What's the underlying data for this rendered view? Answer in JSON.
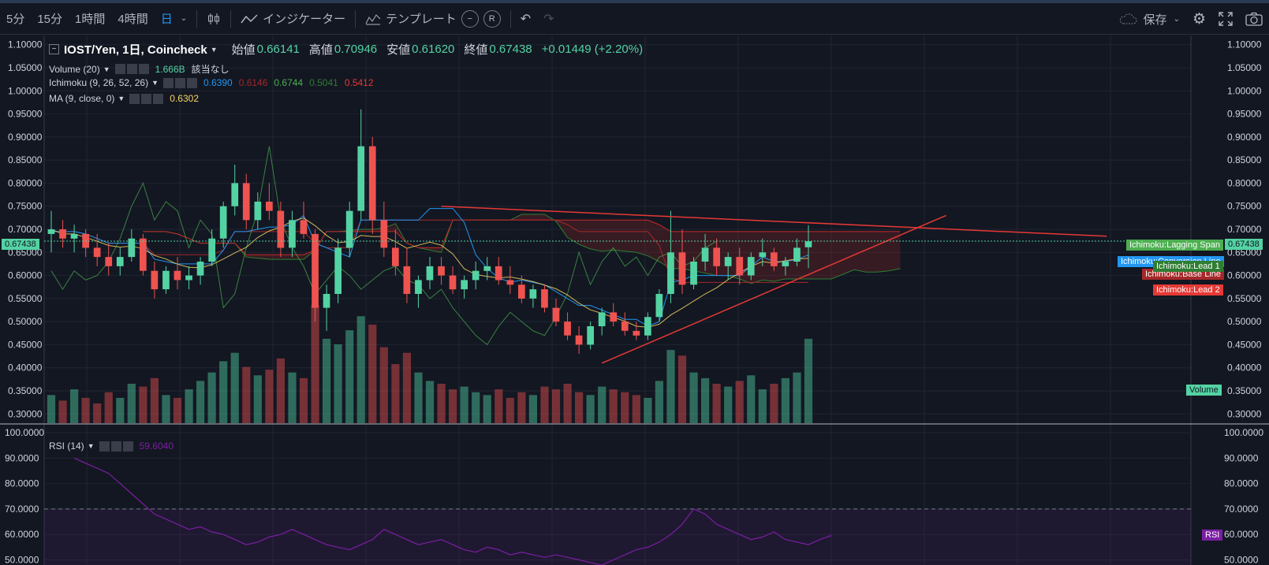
{
  "toolbar": {
    "intervals": [
      "5分",
      "15分",
      "1時間",
      "4時間",
      "日"
    ],
    "active_interval": "日",
    "indicators_label": "インジケーター",
    "templates_label": "テンプレート",
    "r_label": "R",
    "save_label": "保存"
  },
  "legend": {
    "symbol": "IOST/Yen, 1日, Coincheck",
    "open_label": "始値",
    "open": "0.66141",
    "high_label": "高値",
    "high": "0.70946",
    "low_label": "安値",
    "low": "0.61620",
    "close_label": "終値",
    "close": "0.67438",
    "change": "+0.01449 (+2.20%)",
    "volume_title": "Volume (20)",
    "volume_value": "1.666B",
    "volume_note": "該当なし",
    "ichimoku_title": "Ichimoku (9, 26, 52, 26)",
    "ichimoku_values": [
      "0.6390",
      "0.6146",
      "0.6744",
      "0.5041",
      "0.5412"
    ],
    "ma_title": "MA (9, close, 0)",
    "ma_value": "0.6302",
    "rsi_title": "RSI (14)",
    "rsi_value": "59.6040"
  },
  "colors": {
    "bg": "#131722",
    "grid": "#1f2533",
    "up": "#53d3a3",
    "down": "#ef5350",
    "conversion": "#2196f3",
    "base": "#a52828",
    "lagging": "#4caf50",
    "lead1": "#2e7d32",
    "lead2": "#c62828",
    "ma": "#f6d365",
    "rsi": "#7b1fa2",
    "trendline": "#e53935"
  },
  "price_axis": [
    "1.10000",
    "1.05000",
    "1.00000",
    "0.95000",
    "0.90000",
    "0.85000",
    "0.80000",
    "0.75000",
    "0.70000",
    "0.65000",
    "0.60000",
    "0.55000",
    "0.50000",
    "0.45000",
    "0.40000",
    "0.35000",
    "0.30000"
  ],
  "rsi_axis": [
    "100.0000",
    "90.0000",
    "80.0000",
    "70.0000",
    "60.0000",
    "50.0000"
  ],
  "price_tag": "0.67438",
  "series_tags": {
    "lagging": "Ichimoku:Lagging Span",
    "conversion": "Ichimoku:Conversion Line",
    "lead1": "Ichimoku:Lead 1",
    "base": "Ichimoku:Base Line",
    "lead2": "Ichimoku:Lead 2",
    "volume": "Volume",
    "rsi": "RSI"
  },
  "chart_data": {
    "type": "candlestick",
    "title": "IOST/Yen, 1日, Coincheck",
    "price_range": [
      0.28,
      1.12
    ],
    "rsi_range": [
      48,
      100
    ],
    "rsi_levels": [
      70
    ],
    "current_close": 0.67438,
    "trendlines": [
      {
        "from": [
          34,
          0.75
        ],
        "to": [
          92,
          0.685
        ],
        "role": "resistance"
      },
      {
        "from": [
          48,
          0.41
        ],
        "to": [
          78,
          0.73
        ],
        "role": "support"
      }
    ],
    "candles": [
      [
        0.69,
        0.74,
        0.65,
        0.7
      ],
      [
        0.7,
        0.72,
        0.66,
        0.68
      ],
      [
        0.68,
        0.71,
        0.65,
        0.69
      ],
      [
        0.69,
        0.7,
        0.64,
        0.66
      ],
      [
        0.66,
        0.69,
        0.62,
        0.64
      ],
      [
        0.64,
        0.67,
        0.6,
        0.62
      ],
      [
        0.62,
        0.66,
        0.6,
        0.64
      ],
      [
        0.64,
        0.7,
        0.63,
        0.68
      ],
      [
        0.68,
        0.69,
        0.6,
        0.61
      ],
      [
        0.61,
        0.63,
        0.55,
        0.57
      ],
      [
        0.57,
        0.62,
        0.56,
        0.61
      ],
      [
        0.61,
        0.64,
        0.57,
        0.59
      ],
      [
        0.59,
        0.62,
        0.57,
        0.6
      ],
      [
        0.6,
        0.64,
        0.58,
        0.63
      ],
      [
        0.63,
        0.7,
        0.62,
        0.68
      ],
      [
        0.68,
        0.76,
        0.66,
        0.75
      ],
      [
        0.75,
        0.84,
        0.73,
        0.8
      ],
      [
        0.8,
        0.82,
        0.7,
        0.72
      ],
      [
        0.72,
        0.78,
        0.7,
        0.76
      ],
      [
        0.76,
        0.8,
        0.72,
        0.74
      ],
      [
        0.74,
        0.76,
        0.64,
        0.66
      ],
      [
        0.66,
        0.74,
        0.64,
        0.72
      ],
      [
        0.72,
        0.76,
        0.68,
        0.69
      ],
      [
        0.69,
        0.7,
        0.5,
        0.53
      ],
      [
        0.53,
        0.58,
        0.48,
        0.56
      ],
      [
        0.56,
        0.68,
        0.54,
        0.66
      ],
      [
        0.66,
        0.76,
        0.64,
        0.74
      ],
      [
        0.74,
        0.96,
        0.72,
        0.88
      ],
      [
        0.88,
        0.9,
        0.69,
        0.72
      ],
      [
        0.72,
        0.76,
        0.64,
        0.66
      ],
      [
        0.66,
        0.7,
        0.6,
        0.62
      ],
      [
        0.62,
        0.66,
        0.54,
        0.56
      ],
      [
        0.56,
        0.6,
        0.53,
        0.59
      ],
      [
        0.59,
        0.64,
        0.57,
        0.62
      ],
      [
        0.62,
        0.64,
        0.58,
        0.6
      ],
      [
        0.6,
        0.62,
        0.56,
        0.57
      ],
      [
        0.57,
        0.6,
        0.55,
        0.59
      ],
      [
        0.59,
        0.63,
        0.57,
        0.61
      ],
      [
        0.61,
        0.64,
        0.59,
        0.62
      ],
      [
        0.62,
        0.64,
        0.58,
        0.59
      ],
      [
        0.59,
        0.62,
        0.56,
        0.58
      ],
      [
        0.58,
        0.6,
        0.54,
        0.55
      ],
      [
        0.55,
        0.58,
        0.53,
        0.57
      ],
      [
        0.57,
        0.58,
        0.52,
        0.53
      ],
      [
        0.53,
        0.55,
        0.49,
        0.5
      ],
      [
        0.5,
        0.52,
        0.46,
        0.47
      ],
      [
        0.47,
        0.49,
        0.43,
        0.45
      ],
      [
        0.45,
        0.5,
        0.44,
        0.49
      ],
      [
        0.49,
        0.53,
        0.47,
        0.52
      ],
      [
        0.52,
        0.54,
        0.49,
        0.5
      ],
      [
        0.5,
        0.52,
        0.47,
        0.48
      ],
      [
        0.48,
        0.5,
        0.46,
        0.47
      ],
      [
        0.47,
        0.52,
        0.46,
        0.51
      ],
      [
        0.51,
        0.57,
        0.5,
        0.56
      ],
      [
        0.56,
        0.74,
        0.54,
        0.65
      ],
      [
        0.65,
        0.7,
        0.56,
        0.58
      ],
      [
        0.58,
        0.64,
        0.57,
        0.63
      ],
      [
        0.63,
        0.69,
        0.61,
        0.66
      ],
      [
        0.66,
        0.68,
        0.6,
        0.62
      ],
      [
        0.62,
        0.65,
        0.59,
        0.64
      ],
      [
        0.64,
        0.66,
        0.58,
        0.6
      ],
      [
        0.6,
        0.65,
        0.59,
        0.64
      ],
      [
        0.64,
        0.68,
        0.62,
        0.65
      ],
      [
        0.65,
        0.66,
        0.61,
        0.62
      ],
      [
        0.62,
        0.64,
        0.6,
        0.63
      ],
      [
        0.63,
        0.68,
        0.62,
        0.66
      ],
      [
        0.661,
        0.709,
        0.616,
        0.674
      ]
    ],
    "volume": [
      0.1,
      0.08,
      0.12,
      0.09,
      0.07,
      0.11,
      0.09,
      0.14,
      0.13,
      0.16,
      0.1,
      0.09,
      0.12,
      0.15,
      0.18,
      0.22,
      0.25,
      0.2,
      0.17,
      0.19,
      0.23,
      0.18,
      0.16,
      0.42,
      0.3,
      0.28,
      0.33,
      0.38,
      0.35,
      0.27,
      0.21,
      0.25,
      0.18,
      0.15,
      0.14,
      0.12,
      0.13,
      0.11,
      0.1,
      0.12,
      0.09,
      0.11,
      0.1,
      0.13,
      0.12,
      0.14,
      0.11,
      0.1,
      0.13,
      0.12,
      0.11,
      0.1,
      0.09,
      0.15,
      0.26,
      0.24,
      0.18,
      0.16,
      0.14,
      0.13,
      0.15,
      0.17,
      0.12,
      0.14,
      0.16,
      0.18,
      0.3
    ],
    "rsi": [
      90,
      88,
      86,
      84,
      80,
      76,
      72,
      68,
      66,
      64,
      62,
      63,
      61,
      60,
      58,
      56,
      57,
      59,
      60,
      62,
      60,
      58,
      56,
      55,
      54,
      56,
      58,
      62,
      60,
      58,
      56,
      57,
      58,
      56,
      54,
      53,
      55,
      54,
      52,
      53,
      52,
      51,
      52,
      51,
      50,
      49,
      48,
      50,
      52,
      54,
      55,
      57,
      60,
      64,
      70,
      68,
      64,
      62,
      60,
      58,
      59,
      61,
      58,
      57,
      56,
      58,
      59.6
    ]
  }
}
